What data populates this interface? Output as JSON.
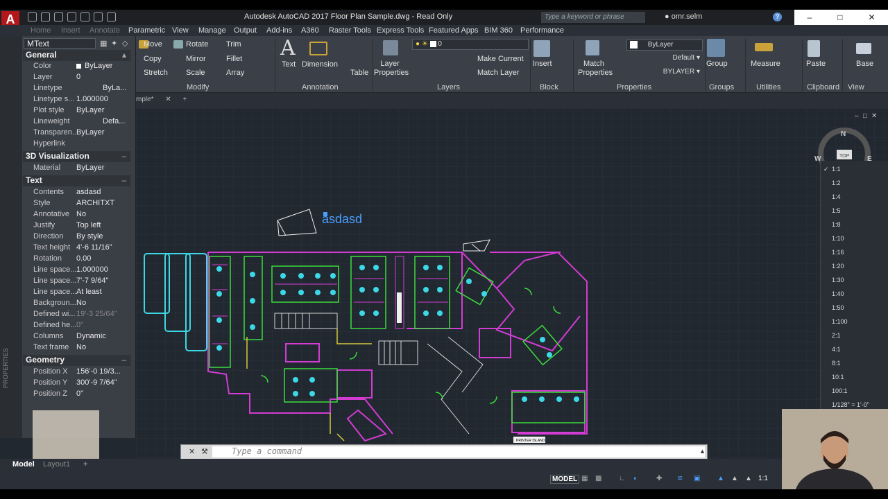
{
  "window": {
    "title": "Autodesk AutoCAD 2017    Floor Plan Sample.dwg - Read Only",
    "search_placeholder": "Type a keyword or phrase",
    "user": "omr.selm",
    "help": "?"
  },
  "app_button": "A",
  "ribbon_tabs": [
    "Home",
    "Insert",
    "Annotate",
    "Parametric",
    "View",
    "Manage",
    "Output",
    "Add-ins",
    "A360",
    "Raster Tools",
    "Express Tools",
    "Featured Apps",
    "BIM 360",
    "Performance"
  ],
  "ribbon": {
    "modify": {
      "move": "Move",
      "rotate": "Rotate",
      "trim": "Trim",
      "copy": "Copy",
      "mirror": "Mirror",
      "fillet": "Fillet",
      "stretch": "Stretch",
      "scale": "Scale",
      "array": "Array",
      "panel": "Modify"
    },
    "annotation": {
      "text": "Text",
      "dimension": "Dimension",
      "table": "Table",
      "panel": "Annotation"
    },
    "layers": {
      "layer_properties": "Layer Properties",
      "current_layer": "0",
      "make_current": "Make Current",
      "match_layer": "Match Layer",
      "panel": "Layers"
    },
    "block": {
      "insert": "Insert",
      "panel": "Block"
    },
    "properties": {
      "match": "Match Properties",
      "color": "ByLayer",
      "linetype": "Default",
      "lineweight": "BYLAYER",
      "panel": "Properties"
    },
    "groups": {
      "group": "Group",
      "panel": "Groups"
    },
    "utilities": {
      "measure": "Measure",
      "panel": "Utilities"
    },
    "clipboard": {
      "paste": "Paste",
      "panel": "Clipboard"
    },
    "view": {
      "base": "Base",
      "panel": "View"
    }
  },
  "doc_tab": "mple*",
  "palette": {
    "object_type": "MText",
    "sections": {
      "general": {
        "title": "General",
        "rows": [
          {
            "k": "Color",
            "v": "ByLayer"
          },
          {
            "k": "Layer",
            "v": "0"
          },
          {
            "k": "Linetype",
            "v": "ByLa..."
          },
          {
            "k": "Linetype s...",
            "v": "1.000000"
          },
          {
            "k": "Plot style",
            "v": "ByLayer"
          },
          {
            "k": "Lineweight",
            "v": "Defa..."
          },
          {
            "k": "Transparen...",
            "v": "ByLayer"
          },
          {
            "k": "Hyperlink",
            "v": ""
          }
        ]
      },
      "viz3d": {
        "title": "3D Visualization",
        "rows": [
          {
            "k": "Material",
            "v": "ByLayer"
          }
        ]
      },
      "text": {
        "title": "Text",
        "rows": [
          {
            "k": "Contents",
            "v": "asdasd"
          },
          {
            "k": "Style",
            "v": "ARCHITXT"
          },
          {
            "k": "Annotative",
            "v": "No"
          },
          {
            "k": "Justify",
            "v": "Top left"
          },
          {
            "k": "Direction",
            "v": "By style"
          },
          {
            "k": "Text height",
            "v": "4'-6 11/16\""
          },
          {
            "k": "Rotation",
            "v": "0.00"
          },
          {
            "k": "Line space...",
            "v": "1.000000"
          },
          {
            "k": "Line space...",
            "v": "7'-7 9/64\""
          },
          {
            "k": "Line space...",
            "v": "At least"
          },
          {
            "k": "Backgroun...",
            "v": "No"
          },
          {
            "k": "Defined wi...",
            "v": "19'-3 25/64\""
          },
          {
            "k": "Defined he...",
            "v": "0\""
          },
          {
            "k": "Columns",
            "v": "Dynamic"
          },
          {
            "k": "Text frame",
            "v": "No"
          }
        ]
      },
      "geometry": {
        "title": "Geometry",
        "rows": [
          {
            "k": "Position X",
            "v": "156'-0 19/3..."
          },
          {
            "k": "Position Y",
            "v": "300'-9 7/64\""
          },
          {
            "k": "Position Z",
            "v": "0\""
          }
        ]
      }
    },
    "vertical_label": "PROPERTIES"
  },
  "canvas_text": "asdasd",
  "drawing_labels": {
    "printer_island": "PRINTER ISLAND"
  },
  "viewcube": {
    "n": "N",
    "w": "W",
    "e": "E",
    "top": "TOP"
  },
  "scales": [
    "1:1",
    "1:2",
    "1:4",
    "1:5",
    "1:8",
    "1:10",
    "1:16",
    "1:20",
    "1:30",
    "1:40",
    "1:50",
    "1:100",
    "2:1",
    "4:1",
    "8:1",
    "10:1",
    "100:1",
    "1/128\" = 1'-0\""
  ],
  "command_placeholder": "Type a command",
  "status": {
    "model_tab": "Model",
    "layout_tab": "Layout1",
    "model_button": "MODEL",
    "scale": "1:1"
  },
  "colors": {
    "accent": "#b3171b",
    "lines_green": "#3cdc3c",
    "lines_magenta": "#d23cd2",
    "lines_cyan": "#3cd8e6",
    "selected_text": "#4aa0ff"
  }
}
